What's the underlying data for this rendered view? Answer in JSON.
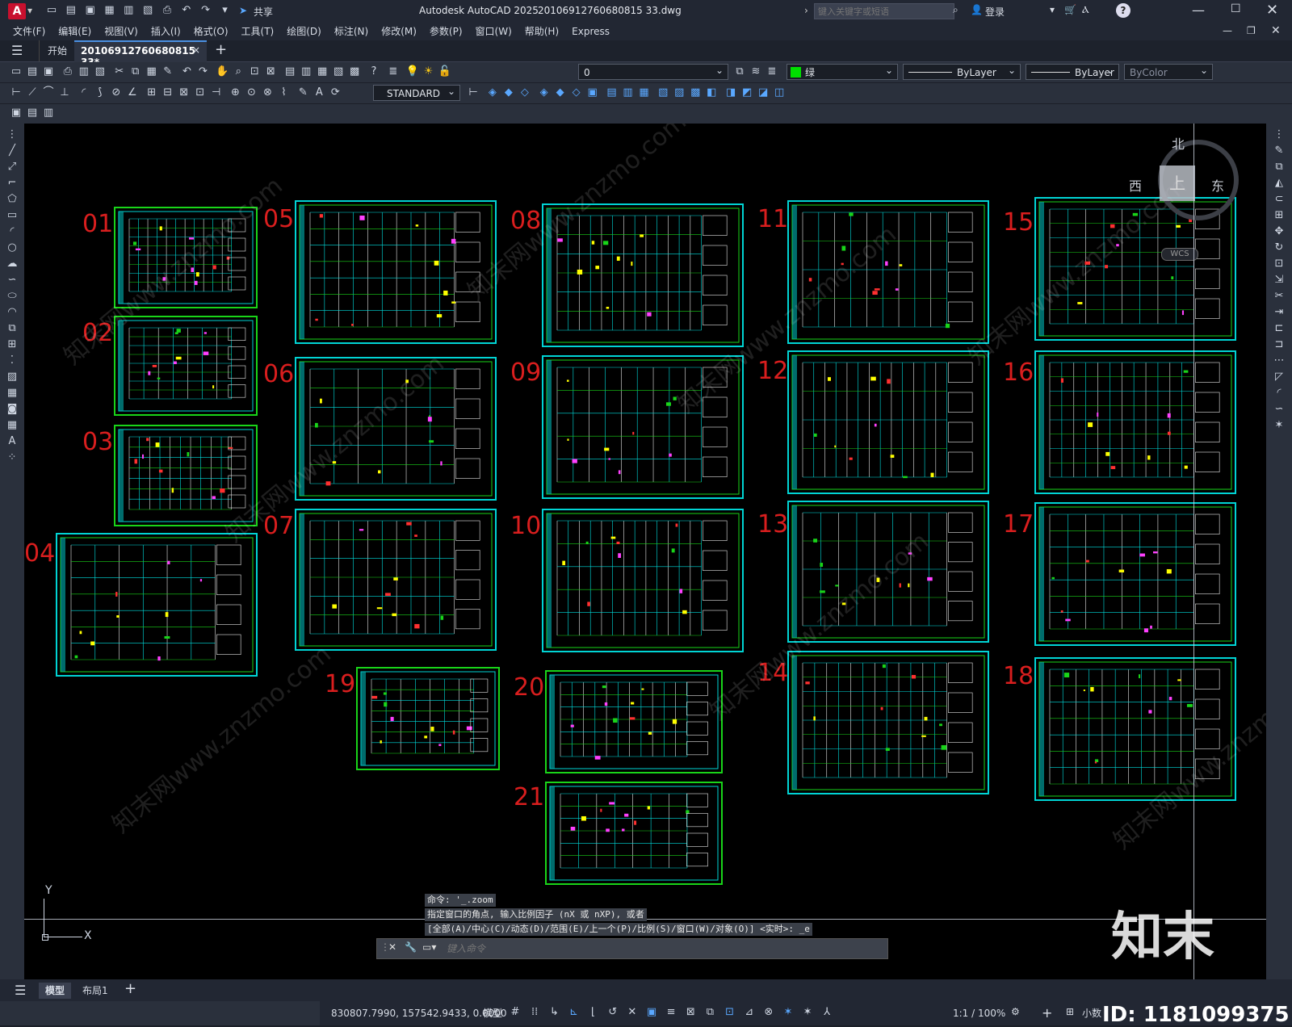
{
  "app": {
    "title": "Autodesk AutoCAD 2025",
    "filename": "20106912760680815 33.dwg",
    "search_placeholder": "键入关键字或短语",
    "login_label": "登录",
    "share_label": "共享",
    "logo_letter": "A"
  },
  "menu": [
    "文件(F)",
    "编辑(E)",
    "视图(V)",
    "插入(I)",
    "格式(O)",
    "工具(T)",
    "绘图(D)",
    "标注(N)",
    "修改(M)",
    "参数(P)",
    "窗口(W)",
    "帮助(H)",
    "Express"
  ],
  "tabs": {
    "start_label": "开始",
    "doc_label": "20106912760680815 33*",
    "close_glyph": "×",
    "add_glyph": "+"
  },
  "properties": {
    "layer_value": "0",
    "color_value": "绿",
    "linetype_value": "ByLayer",
    "lineweight_value": "ByLayer",
    "plotstyle_value": "ByColor",
    "textstyle_value": "STANDARD"
  },
  "viewcube": {
    "north": "北",
    "south": "",
    "west": "西",
    "east": "东",
    "face": "上",
    "wcs": "WCS"
  },
  "ucs": {
    "x_label": "X",
    "y_label": "Y"
  },
  "sheets": [
    {
      "num": "01"
    },
    {
      "num": "02"
    },
    {
      "num": "03"
    },
    {
      "num": "04"
    },
    {
      "num": "05"
    },
    {
      "num": "06"
    },
    {
      "num": "07"
    },
    {
      "num": "08"
    },
    {
      "num": "09"
    },
    {
      "num": "10"
    },
    {
      "num": "11"
    },
    {
      "num": "12"
    },
    {
      "num": "13"
    },
    {
      "num": "14"
    },
    {
      "num": "15"
    },
    {
      "num": "16"
    },
    {
      "num": "17"
    },
    {
      "num": "18"
    },
    {
      "num": "19"
    },
    {
      "num": "20"
    },
    {
      "num": "21"
    }
  ],
  "command": {
    "history": [
      "命令: '_.zoom",
      "指定窗口的角点, 输入比例因子 (nX 或 nXP), 或者",
      "[全部(A)/中心(C)/动态(D)/范围(E)/上一个(P)/比例(S)/窗口(W)/对象(O)] <实时>: _e"
    ],
    "input_placeholder": "键入命令"
  },
  "layout_tabs": {
    "model": "模型",
    "layout1": "布局1",
    "add": "+"
  },
  "status": {
    "coords": "830807.7990, 157542.9433, 0.0000",
    "space": "模型",
    "scale": "1:1 / 100%",
    "units": "小数"
  },
  "watermark": {
    "brand": "知末",
    "id_text": "ID: 1181099375",
    "diag_text": "知末网www.znzmo.com"
  }
}
